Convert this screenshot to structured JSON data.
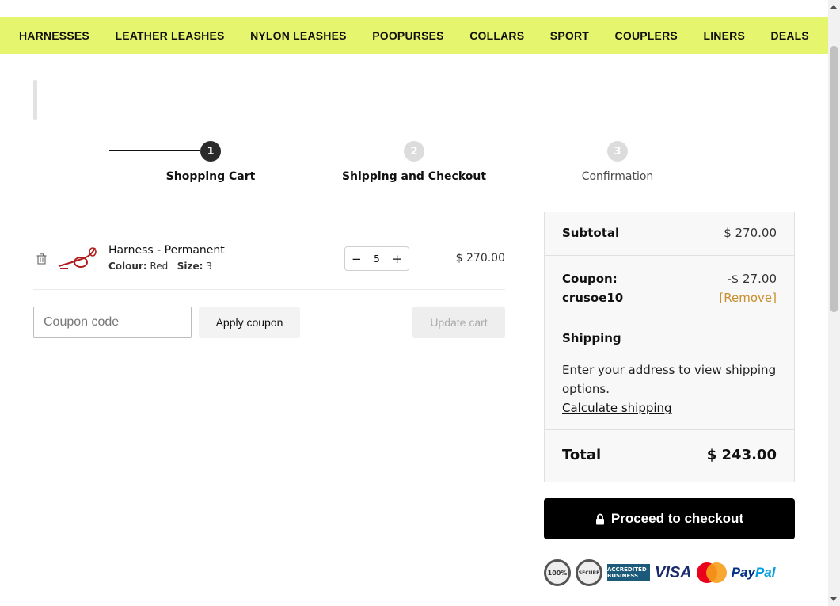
{
  "nav": {
    "items": [
      "HARNESSES",
      "LEATHER LEASHES",
      "NYLON LEASHES",
      "POOPURSES",
      "COLLARS",
      "SPORT",
      "COUPLERS",
      "LINERS",
      "DEALS"
    ]
  },
  "steps": [
    {
      "num": "1",
      "label": "Shopping Cart"
    },
    {
      "num": "2",
      "label": "Shipping and Checkout"
    },
    {
      "num": "3",
      "label": "Confirmation"
    }
  ],
  "cart": {
    "item": {
      "name": "Harness - Permanent",
      "colour_label": "Colour:",
      "colour_value": "Red",
      "size_label": "Size:",
      "size_value": "3",
      "quantity": "5",
      "price": "$ 270.00"
    },
    "coupon_placeholder": "Coupon code",
    "apply_label": "Apply coupon",
    "update_label": "Update cart"
  },
  "summary": {
    "subtotal_label": "Subtotal",
    "subtotal_value": "$ 270.00",
    "coupon_label": "Coupon:",
    "coupon_code": "crusoe10",
    "coupon_value": "-$ 27.00",
    "remove_label": "[Remove]",
    "shipping_label": "Shipping",
    "shipping_text": "Enter your address to view shipping options.",
    "calc_label": "Calculate shipping",
    "total_label": "Total",
    "total_value": "$ 243.00"
  },
  "checkout": {
    "label": "Proceed to checkout",
    "icon": "lock-icon"
  },
  "badges": {
    "seal1": "100%",
    "seal2": "SECURE",
    "bbb": "ACCREDITED BUSINESS",
    "visa": "VISA",
    "mastercard": "MasterCard",
    "paypal_a": "Pay",
    "paypal_b": "Pal"
  }
}
